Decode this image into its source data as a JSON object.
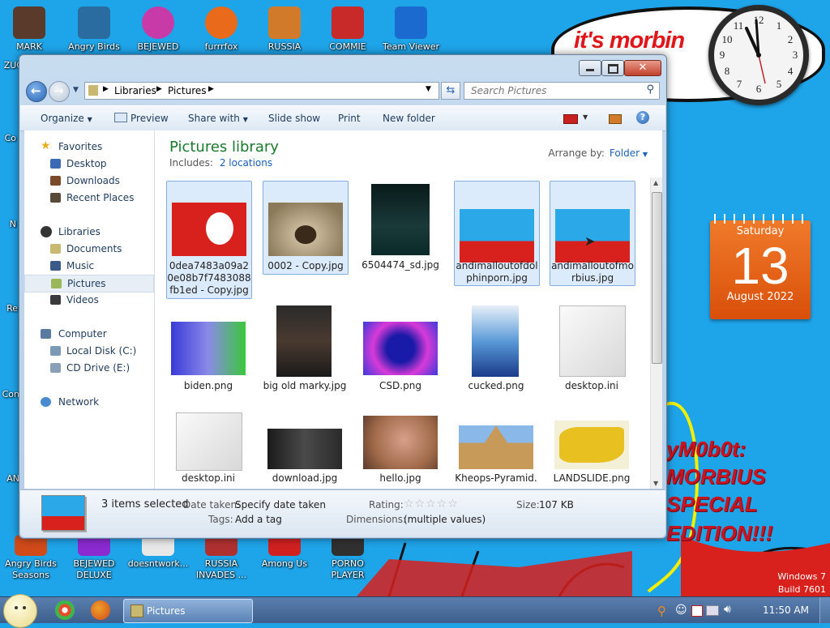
{
  "desktop": {
    "icons_top": [
      {
        "label": "MARK",
        "color": "#5a3a2a"
      },
      {
        "label": "Angry Birds",
        "color": "#2a6ca0"
      },
      {
        "label": "BEJEWED",
        "color": "#c83aa8"
      },
      {
        "label": "furrrfox",
        "color": "#e86a1a"
      },
      {
        "label": "RUSSIA",
        "color": "#d07a2a"
      },
      {
        "label": "COMMIE",
        "color": "#c82a2a"
      },
      {
        "label": "Team Viewer",
        "color": "#1a6ad0"
      }
    ],
    "icons_left_cut": [
      "ZUC",
      "Co",
      "N",
      "Re",
      "Con",
      "AN"
    ],
    "icons_bottom": [
      {
        "label": "Angry Birds Seasons",
        "color": "#d04a1a"
      },
      {
        "label": "BEJEWED DELUXE",
        "color": "#8a2ad0"
      },
      {
        "label": "doesntwork...",
        "color": "#e8e8e8"
      },
      {
        "label": "RUSSIA INVADES ...",
        "color": "#b03030"
      },
      {
        "label": "Among Us",
        "color": "#d02020"
      },
      {
        "label": "PORNO PLAYER",
        "color": "#303030"
      }
    ],
    "bubble_text": "it's morbin",
    "clock": {
      "time": "11:58"
    },
    "calendar": {
      "weekday": "Saturday",
      "day": "13",
      "month_year": "August 2022"
    },
    "red_caption": [
      "yM0b0t:",
      "MORBIUS",
      "SPECIAL",
      "EDITION!!!"
    ],
    "windows_version": [
      "Windows 7",
      "Build 7601"
    ]
  },
  "window": {
    "breadcrumb": [
      "Libraries",
      "Pictures"
    ],
    "search_placeholder": "Search Pictures",
    "toolbar": {
      "organize": "Organize",
      "preview": "Preview",
      "share_with": "Share with",
      "slide_show": "Slide show",
      "print": "Print",
      "new_folder": "New folder"
    },
    "nav": {
      "favorites": "Favorites",
      "desktop": "Desktop",
      "downloads": "Downloads",
      "recent_places": "Recent Places",
      "libraries": "Libraries",
      "documents": "Documents",
      "music": "Music",
      "pictures": "Pictures",
      "videos": "Videos",
      "computer": "Computer",
      "local_disk": "Local Disk (C:)",
      "cd_drive": "CD Drive (E:)",
      "network": "Network"
    },
    "library": {
      "title": "Pictures library",
      "includes_label": "Includes:",
      "includes_link": "2 locations",
      "arrange_label": "Arrange by:",
      "arrange_value": "Folder"
    },
    "files": [
      {
        "name": "0dea7483a09a20e08b7f7483088fb1ed - Copy.jpg",
        "selected": true,
        "color": "#d8201c"
      },
      {
        "name": "0002 - Copy.jpg",
        "selected": true,
        "color": "#8a7a5a"
      },
      {
        "name": "6504474_sd.jpg",
        "selected": false,
        "color": "#1a3a3a"
      },
      {
        "name": "andimalloutofdolphinporn.jpg",
        "selected": true,
        "color": "#2aa8e8"
      },
      {
        "name": "andimalloutofmorbius.jpg",
        "selected": true,
        "color": "#2aa8e8"
      },
      {
        "name": "biden.png",
        "selected": false,
        "color": "#4a48c8"
      },
      {
        "name": "big old marky.jpg",
        "selected": false,
        "color": "#2a2a2a"
      },
      {
        "name": "CSD.png",
        "selected": false,
        "color": "#3a3ad8"
      },
      {
        "name": "cucked.png",
        "selected": false,
        "color": "#5a9ad8"
      },
      {
        "name": "desktop.ini",
        "selected": false,
        "color": "#e8e8e8"
      },
      {
        "name": "desktop.ini",
        "selected": false,
        "color": "#e8e8e8"
      },
      {
        "name": "download.jpg",
        "selected": false,
        "color": "#2a2a2a"
      },
      {
        "name": "hello.jpg",
        "selected": false,
        "color": "#a06a4a"
      },
      {
        "name": "Kheops-Pyramid.",
        "selected": false,
        "color": "#c89a5a"
      },
      {
        "name": "LANDSLIDE.png",
        "selected": false,
        "color": "#e8c020"
      }
    ],
    "details": {
      "count_text": "3 items selected",
      "date_taken_label": "Date taken:",
      "date_taken_value": "Specify date taken",
      "tags_label": "Tags:",
      "tags_value": "Add a tag",
      "rating_label": "Rating:",
      "dimensions_label": "Dimensions:",
      "dimensions_value": "(multiple values)",
      "size_label": "Size:",
      "size_value": "107 KB"
    }
  },
  "taskbar": {
    "active_window": "Pictures",
    "time": "11:50 AM"
  }
}
